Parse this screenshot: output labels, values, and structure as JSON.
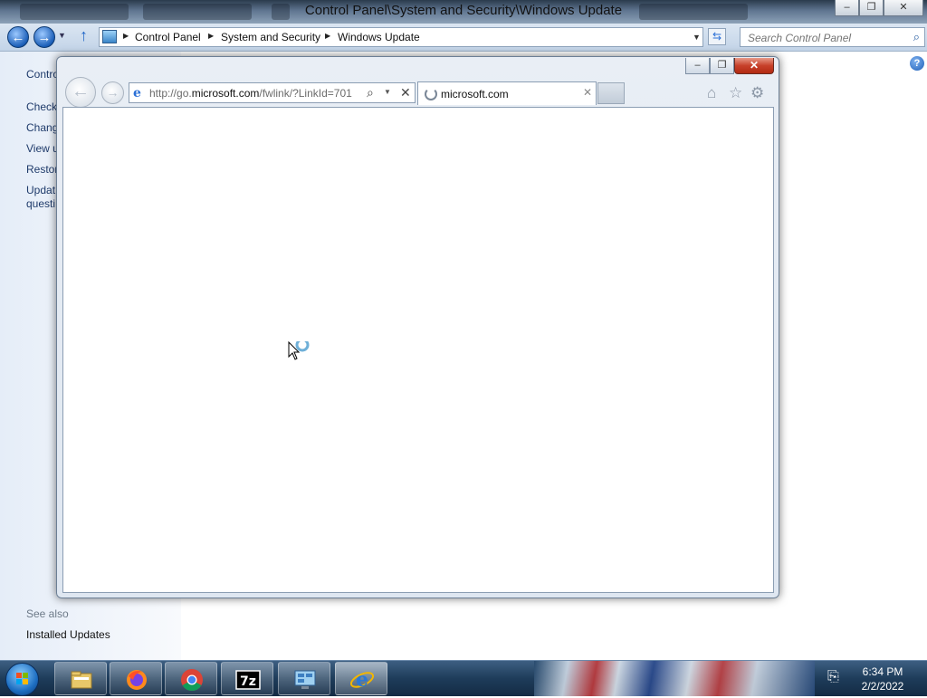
{
  "control_panel": {
    "title": "Control Panel\\System and Security\\Windows Update",
    "breadcrumb": [
      "Control Panel",
      "System and Security",
      "Windows Update"
    ],
    "search_placeholder": "Search Control Panel",
    "sidebar": {
      "items": [
        "Contro",
        "Check",
        "Chang",
        "View u",
        "Restor",
        "Updat",
        "questi"
      ],
      "see_also_label": "See also",
      "see_also_items": [
        "Installed Updates"
      ]
    },
    "help_label": "?"
  },
  "ie": {
    "url_prefix": "http://go.",
    "url_domain": "microsoft.com",
    "url_suffix": "/fwlink/?LinkId=701",
    "tab_title": "microsoft.com",
    "window_buttons": {
      "minimize": "–",
      "maximize": "❐",
      "close": "✕"
    },
    "accent": "#2a6fd6"
  },
  "taskbar": {
    "apps": [
      "Windows Explorer",
      "Firefox",
      "Chrome",
      "7-Zip",
      "Control Panel",
      "Internet Explorer"
    ],
    "clock_time": "6:34 PM",
    "clock_date": "2/2/2022"
  }
}
